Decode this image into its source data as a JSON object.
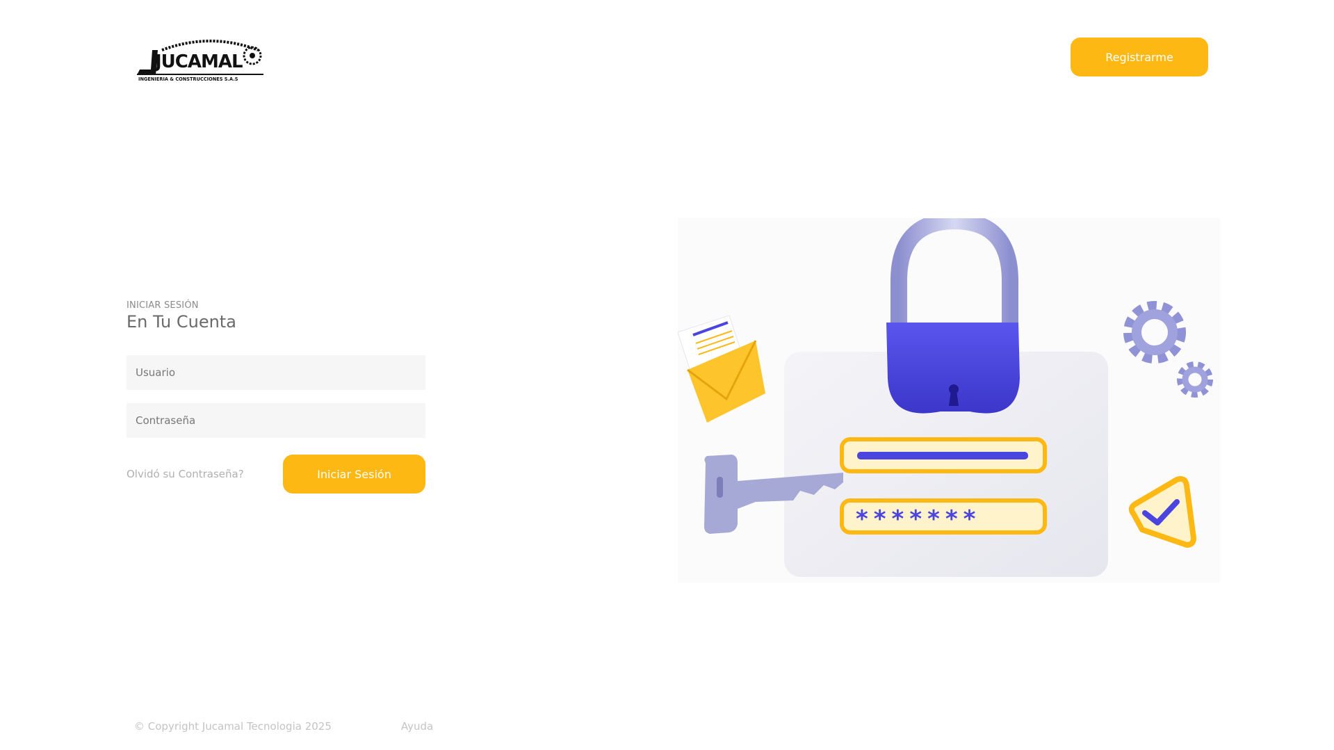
{
  "brand": {
    "name": "JUCAMAL",
    "tagline": "INGENIERIA & CONSTRUCCIONES S.A.S"
  },
  "header": {
    "register_label": "Registrarme"
  },
  "login": {
    "eyebrow": "INICIAR SESIÓN",
    "title": "En Tu Cuenta",
    "username_placeholder": "Usuario",
    "password_placeholder": "Contraseña",
    "forgot_label": "Olvidó su Contraseña?",
    "submit_label": "Iniciar Sesión"
  },
  "illustration": {
    "password_mask": "*******"
  },
  "footer": {
    "copyright": "© Copyright Jucamal Tecnologia 2025",
    "help_label": "Ayuda"
  },
  "colors": {
    "accent": "#fdb813",
    "lock": "#4b45e0",
    "metal": "#a6a8d6"
  }
}
